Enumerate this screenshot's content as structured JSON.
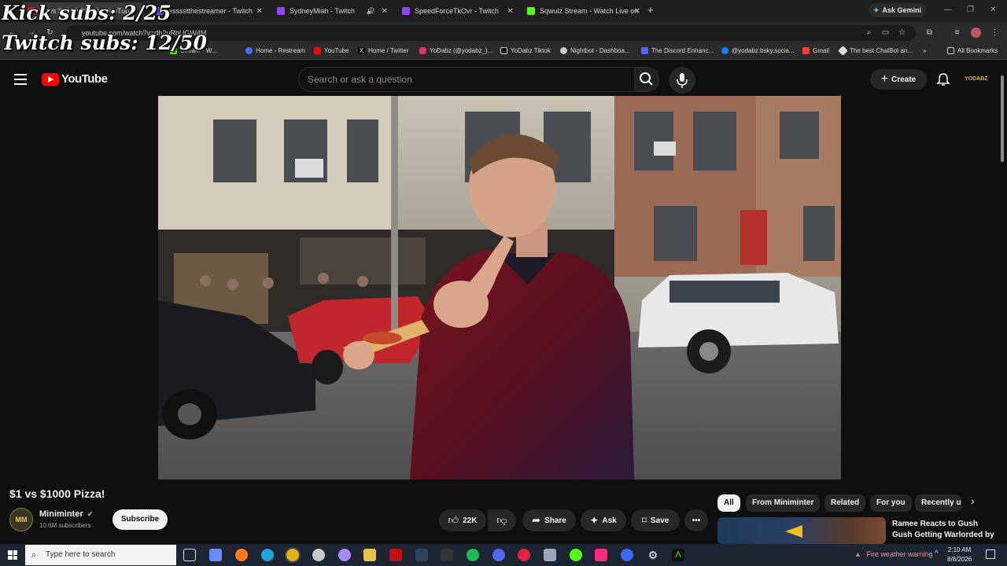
{
  "overlay": {
    "kick_subs": "Kick subs: 2/25",
    "twitch_subs": "Twitch subs: 12/50"
  },
  "browser": {
    "tabs": [
      {
        "label": "$1 vs $1000 Pizza! - YouTube",
        "color": "#ff0000",
        "active": true
      },
      {
        "label": "esssstthestreamer - Twitch",
        "color": "#9146ff"
      },
      {
        "label": "SydneyMiah - Twitch",
        "color": "#9146ff"
      },
      {
        "label": "SpeedForceTkOvr - Twitch",
        "color": "#9146ff"
      },
      {
        "label": "Sqwulz Stream - Watch Live on",
        "color": "#53fc18"
      }
    ],
    "ask_gemini": "Ask Gemini",
    "url": "youtube.com/watch?v=dh2uRbUGW4M",
    "bookmarks": [
      {
        "label": "Stream - W...",
        "color": "#53fc18"
      },
      {
        "label": "Home - Restream",
        "color": "#4a6cf7"
      },
      {
        "label": "YouTube",
        "color": "#ff0000"
      },
      {
        "label": "Home / Twitter",
        "color": "#dddddd"
      },
      {
        "label": "YoDabz (@yodabz_)...",
        "color": "#e1306c"
      },
      {
        "label": "YoDabz Tiktok",
        "color": "#ffffff"
      },
      {
        "label": "Nightbot - Dashboa...",
        "color": "#cccccc"
      },
      {
        "label": "The Discord Enhanc...",
        "color": "#5865f2"
      },
      {
        "label": "@yodabz.bsky.socia...",
        "color": "#1185fe"
      },
      {
        "label": "Gmail",
        "color": "#ea4335"
      },
      {
        "label": "The best ChatBot an...",
        "color": "#dddddd"
      }
    ],
    "all_bookmarks": "All Bookmarks"
  },
  "youtube": {
    "logo": "YouTube",
    "search_placeholder": "Search or ask a question",
    "create": "Create",
    "avatar_text": "YODABZ",
    "video_title": "$1 vs $1000 Pizza!",
    "channel": {
      "avatar_text": "MM",
      "name": "Miniminter",
      "subscribers": "10.6M subscribers"
    },
    "subscribe": "Subscribe",
    "actions": {
      "likes": "22K",
      "share": "Share",
      "ask": "Ask",
      "save": "Save"
    },
    "chips": [
      "All",
      "From Miniminter",
      "Related",
      "For you",
      "Recently u"
    ],
    "recommended": {
      "title": "Ramee Reacts to Gush Gush Getting Warlorded by"
    }
  },
  "taskbar": {
    "search_placeholder": "Type here to search",
    "weather": "Fire weather warning",
    "time": "2:10 AM",
    "date": "8/8/2026"
  },
  "colors": {
    "yt_red": "#ff0000",
    "bg": "#0f0f0f",
    "chip": "#272727",
    "taskbar": "#1c2531"
  }
}
